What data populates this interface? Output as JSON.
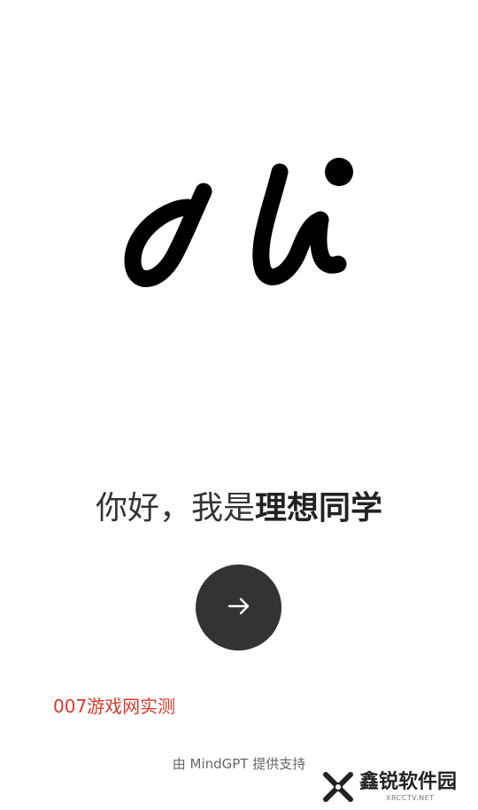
{
  "greeting": {
    "prefix": "你好，我是",
    "name": "理想同学"
  },
  "next_button": {
    "icon": "arrow-right-icon"
  },
  "watermark_test": "007游戏网实测",
  "powered_by": "由 MindGPT 提供支持",
  "brand_watermark": {
    "name": "鑫锐软件园",
    "site": "XRCCTV.NET"
  },
  "colors": {
    "background": "#ffffff",
    "button": "#333333",
    "text": "#333333",
    "watermark_red": "#d9382a"
  }
}
